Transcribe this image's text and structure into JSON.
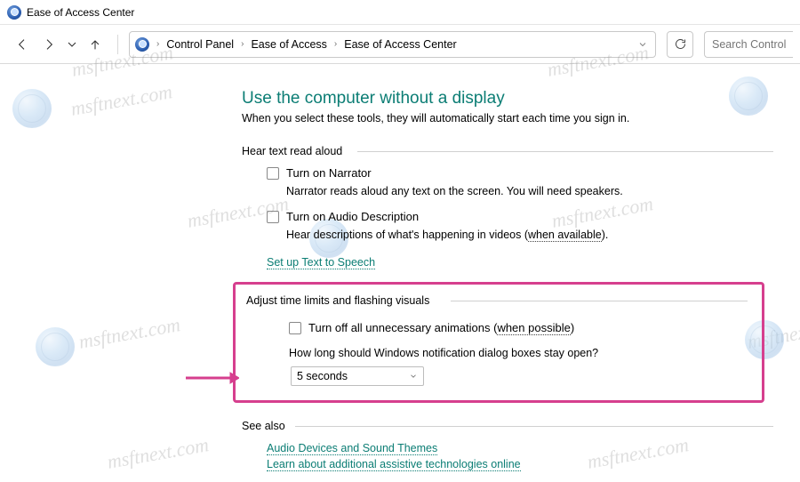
{
  "window": {
    "title": "Ease of Access Center"
  },
  "breadcrumb": {
    "items": [
      "Control Panel",
      "Ease of Access",
      "Ease of Access Center"
    ]
  },
  "search": {
    "placeholder": "Search Control Panel"
  },
  "page": {
    "heading": "Use the computer without a display",
    "subheading": "When you select these tools, they will automatically start each time you sign in."
  },
  "group_aloud": {
    "legend": "Hear text read aloud",
    "narrator": {
      "label": "Turn on Narrator",
      "desc": "Narrator reads aloud any text on the screen. You will need speakers."
    },
    "audiodesc": {
      "label": "Turn on Audio Description",
      "desc_pre": "Hear descriptions of what's happening in videos (",
      "desc_dotted": "when available",
      "desc_post": ")."
    },
    "tts_link": "Set up Text to Speech"
  },
  "group_visuals": {
    "legend": "Adjust time limits and flashing visuals",
    "anim": {
      "label_pre": "Turn off all unnecessary animations (",
      "label_dotted": "when possible",
      "label_post": ")"
    },
    "notif_label": "How long should Windows notification dialog boxes stay open?",
    "notif_value": "5 seconds"
  },
  "seealso": {
    "legend": "See also",
    "links": [
      "Audio Devices and Sound Themes",
      "Learn about additional assistive technologies online"
    ]
  },
  "watermark": "msftnext.com"
}
